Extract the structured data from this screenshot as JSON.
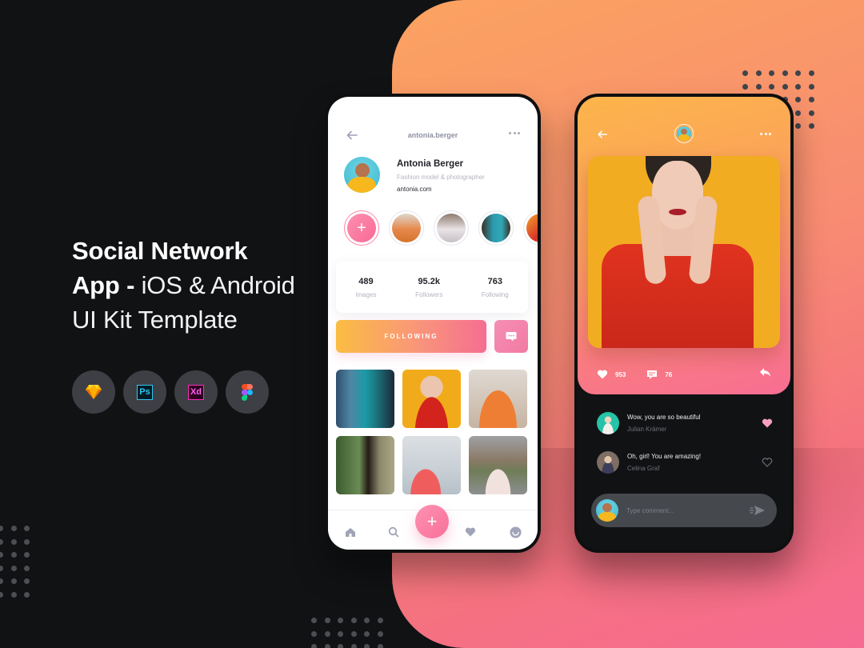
{
  "hero": {
    "line1": "Social Network",
    "line2_bold": "App - ",
    "line2_light": " iOS & Android",
    "line3": "UI Kit Template"
  },
  "tools": [
    {
      "name": "sketch",
      "icon": "sketch-icon"
    },
    {
      "name": "photoshop",
      "label": "Ps",
      "icon": "photoshop-icon"
    },
    {
      "name": "xd",
      "label": "Xd",
      "icon": "xd-icon"
    },
    {
      "name": "figma",
      "icon": "figma-icon"
    }
  ],
  "profile_screen": {
    "header": {
      "username": "antonia.berger"
    },
    "profile": {
      "name": "Antonia Berger",
      "bio": "Fashion model & photographer",
      "link": "antonia.com"
    },
    "stories": {
      "add_label": "+",
      "count": 4
    },
    "stats": [
      {
        "value": "489",
        "label": "Images"
      },
      {
        "value": "95.2k",
        "label": "Followers"
      },
      {
        "value": "763",
        "label": "Following"
      }
    ],
    "follow_button": "FOLLOWING",
    "photo_grid_count": 6,
    "fab_label": "+",
    "bottom_nav": [
      "home",
      "search",
      "favorites",
      "profile"
    ]
  },
  "post_screen": {
    "stats": {
      "likes": "953",
      "comments": "76"
    },
    "comments": [
      {
        "message": "Wow, you are so beautiful",
        "author": "Julian Krämer",
        "liked": true
      },
      {
        "message": "Oh, girl! You are amazing!",
        "author": "Celina Graf",
        "liked": false
      }
    ],
    "comment_input": {
      "placeholder": "Type comment...",
      "value": ""
    }
  },
  "colors": {
    "accent_pink": "#f86a96",
    "accent_orange": "#fbbd42",
    "background_dark": "#111214"
  }
}
